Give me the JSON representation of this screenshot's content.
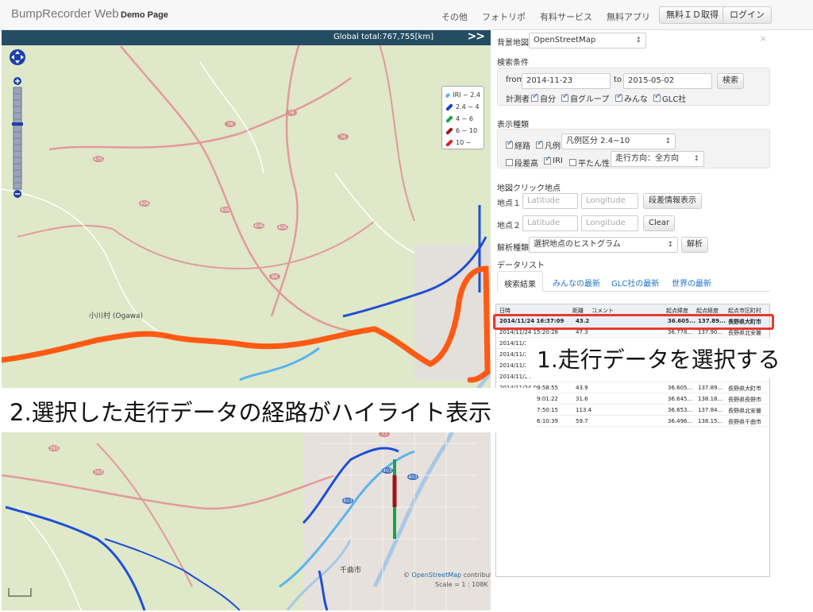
{
  "navbar": {
    "brand": "BumpRecorder Web",
    "page_label": "Demo Page",
    "links": [
      "その他",
      "フォトリポ",
      "有料サービス",
      "無料アプリ"
    ],
    "get_id_button": "無料ＩＤ取得",
    "login_button": "ログイン"
  },
  "map": {
    "global_total": "Global total:767,755[km]",
    "expand_label": ">>",
    "legend": [
      {
        "label": "IRI ~ 2.4",
        "color": "#5ab4ee"
      },
      {
        "label": "2.4 ~ 4",
        "color": "#1d3fd8"
      },
      {
        "label": "4 ~ 6",
        "color": "#1aa34a"
      },
      {
        "label": "6 ~ 10",
        "color": "#a01414"
      },
      {
        "label": "10 ~",
        "color": "#e61e1e"
      }
    ],
    "attribution_prefix": "© ",
    "attribution_link": "OpenStreetMap",
    "attribution_suffix": " contributors",
    "scale": "Scale = 1 : 108K",
    "place_ogawa": "小川村 (Ogawa)",
    "place_chikuma": "千曲市",
    "route_numbers": [
      "36",
      "76",
      "36",
      "435",
      "406",
      "406",
      "406",
      "406",
      "86",
      "393",
      "393",
      "77",
      "403",
      "403",
      "403"
    ],
    "highlight_color": "#ff5a14"
  },
  "panel": {
    "close_label": "×",
    "basemap_label": "背景地図",
    "basemap_value": "OpenStreetMap",
    "search_title": "検索条件",
    "from_label": "from",
    "from_value": "2014-11-23",
    "to_label": "to",
    "to_value": "2015-05-02",
    "search_button": "検索",
    "measurer_label": "計測者",
    "measurer_options": [
      "自分",
      "自グループ",
      "みんな",
      "GLC社"
    ],
    "display_title": "表示種類",
    "display_route": "経路",
    "display_legend": "凡例",
    "legend_class_value": "凡例区分 2.4~10",
    "display_step": "段差高",
    "display_iri": "IRI",
    "display_flatness": "平たん性",
    "direction_value": "走行方向：全方向",
    "click_title": "地図クリック地点",
    "point1_label": "地点１",
    "point2_label": "地点２",
    "lat_placeholder": "Latitude",
    "lng_placeholder": "Longitude",
    "step_info_button": "段差情報表示",
    "clear_button": "Clear",
    "analysis_label": "解析種類",
    "analysis_value": "選択地点のヒストグラム",
    "analysis_button": "解析",
    "datalist_title": "データリスト",
    "tabs": [
      "検索結果",
      "みんなの最新",
      "GLC社の最新",
      "世界の最新"
    ],
    "table_headers": [
      "日時",
      "距離",
      "コメント",
      "起点緯度",
      "起点経度",
      "起点市区町村"
    ],
    "rows": [
      {
        "date": "2014/11/24 16:37:09",
        "dist": "43.2",
        "comment": "",
        "lat": "36.605...",
        "lng": "137.89...",
        "city": "長野県大町市",
        "selected": true
      },
      {
        "date": "2014/11/24 15:20:28",
        "dist": "47.3",
        "comment": "",
        "lat": "36.778...",
        "lng": "137.90...",
        "city": "長野県北安曇",
        "selected": false
      },
      {
        "date": "2014/11/24",
        "dist": "",
        "comment": "",
        "lat": "",
        "lng": "",
        "city": "",
        "selected": false
      },
      {
        "date": "2014/11/24",
        "dist": "",
        "comment": "",
        "lat": "",
        "lng": "",
        "city": "",
        "selected": false
      },
      {
        "date": "2014/11/24",
        "dist": "",
        "comment": "",
        "lat": "",
        "lng": "",
        "city": "",
        "selected": false
      },
      {
        "date": "2014/11/24",
        "dist": "",
        "comment": "",
        "lat": "",
        "lng": "",
        "city": "",
        "selected": false
      },
      {
        "date": "2014/11/24 09:58:55",
        "dist": "43.9",
        "comment": "",
        "lat": "36.605...",
        "lng": "137.89...",
        "city": "長野県大町市",
        "selected": false
      },
      {
        "date": "2014/11/24 09:01:22",
        "dist": "31.6",
        "comment": "",
        "lat": "36.645...",
        "lng": "138.18...",
        "city": "長野県長野市",
        "selected": false
      },
      {
        "date": "2014/11/24 17:50:15",
        "dist": "113.4",
        "comment": "",
        "lat": "36.653...",
        "lng": "137.84...",
        "city": "長野県北安曇",
        "selected": false
      },
      {
        "date": "2014/11/24 16:10:39",
        "dist": "59.7",
        "comment": "",
        "lat": "36.496...",
        "lng": "138.15...",
        "city": "長野県千曲市",
        "selected": false
      }
    ]
  },
  "annotations": {
    "step1": "1.走行データを選択する",
    "step2": "2.選択した走行データの経路がハイライト表示"
  }
}
